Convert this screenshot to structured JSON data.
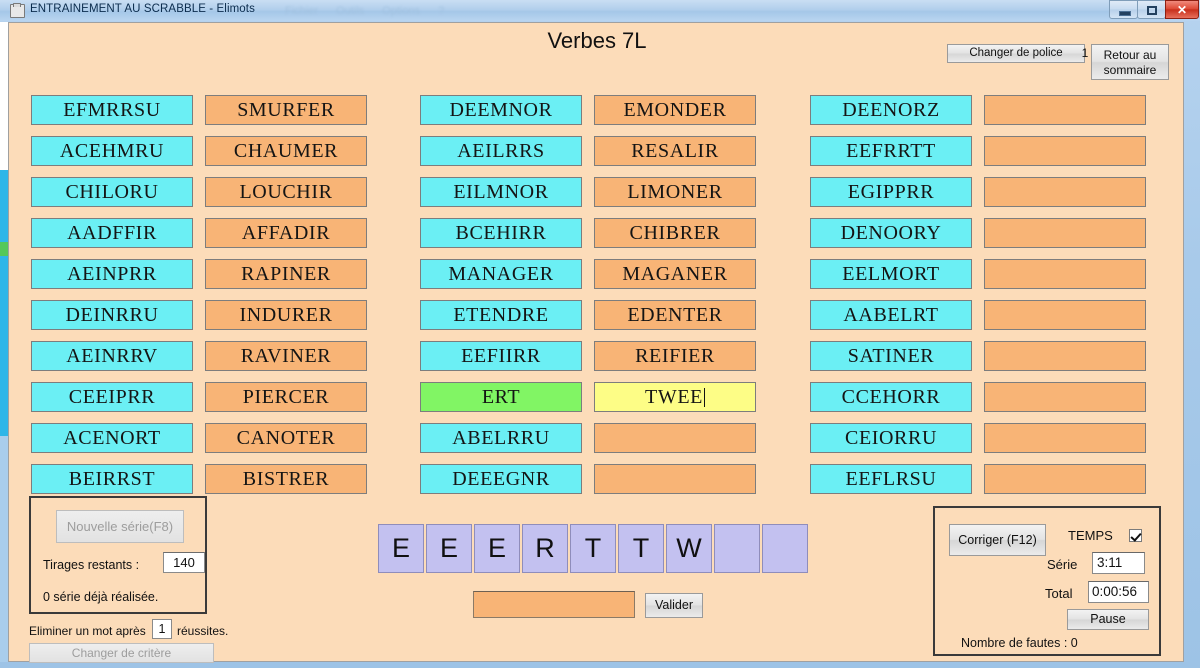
{
  "window": {
    "title": "ENTRAINEMENT AU SCRABBLE - Elimots",
    "icon": "window-app-icon",
    "menu_ghost": [
      "Fichier",
      "Outils",
      "Options",
      "?"
    ],
    "controls": {
      "minimize": "minimize-icon",
      "maximize": "maximize-icon",
      "close": "✕"
    }
  },
  "header": {
    "page_title": "Verbes 7L",
    "change_font_button": "Changer de police",
    "font_index": "1",
    "back_button": "Retour au sommaire"
  },
  "grid": {
    "columns": [
      {
        "rows": [
          {
            "left": "EFMRRSU",
            "left_state": "cyan",
            "right": "SMURFER",
            "right_state": "orange"
          },
          {
            "left": "ACEHMRU",
            "left_state": "cyan",
            "right": "CHAUMER",
            "right_state": "orange"
          },
          {
            "left": "CHILORU",
            "left_state": "cyan",
            "right": "LOUCHIR",
            "right_state": "orange"
          },
          {
            "left": "AADFFIR",
            "left_state": "cyan",
            "right": "AFFADIR",
            "right_state": "orange"
          },
          {
            "left": "AEINPRR",
            "left_state": "cyan",
            "right": "RAPINER",
            "right_state": "orange"
          },
          {
            "left": "DEINRRU",
            "left_state": "cyan",
            "right": "INDURER",
            "right_state": "orange"
          },
          {
            "left": "AEINRRV",
            "left_state": "cyan",
            "right": "RAVINER",
            "right_state": "orange"
          },
          {
            "left": "CEEIPRR",
            "left_state": "cyan",
            "right": "PIERCER",
            "right_state": "orange"
          },
          {
            "left": "ACENORT",
            "left_state": "cyan",
            "right": "CANOTER",
            "right_state": "orange"
          },
          {
            "left": "BEIRRST",
            "left_state": "cyan",
            "right": "BISTRER",
            "right_state": "orange"
          }
        ]
      },
      {
        "rows": [
          {
            "left": "DEEMNOR",
            "left_state": "cyan",
            "right": "EMONDER",
            "right_state": "orange"
          },
          {
            "left": "AEILRRS",
            "left_state": "cyan",
            "right": "RESALIR",
            "right_state": "orange"
          },
          {
            "left": "EILMNOR",
            "left_state": "cyan",
            "right": "LIMONER",
            "right_state": "orange"
          },
          {
            "left": "BCEHIRR",
            "left_state": "cyan",
            "right": "CHIBRER",
            "right_state": "orange"
          },
          {
            "left": "MANAGER",
            "left_state": "cyan",
            "right": "MAGANER",
            "right_state": "orange"
          },
          {
            "left": "ETENDRE",
            "left_state": "cyan",
            "right": "EDENTER",
            "right_state": "orange"
          },
          {
            "left": "EEFIIRR",
            "left_state": "cyan",
            "right": "REIFIER",
            "right_state": "orange"
          },
          {
            "left": "ERT",
            "left_state": "green",
            "right": "TWEE",
            "right_state": "yellow",
            "right_caret": true
          },
          {
            "left": "ABELRRU",
            "left_state": "cyan",
            "right": "",
            "right_state": "orange"
          },
          {
            "left": "DEEEGNR",
            "left_state": "cyan",
            "right": "",
            "right_state": "orange"
          }
        ]
      },
      {
        "rows": [
          {
            "left": "DEENORZ",
            "left_state": "cyan",
            "right": "",
            "right_state": "orange"
          },
          {
            "left": "EEFRRTT",
            "left_state": "cyan",
            "right": "",
            "right_state": "orange"
          },
          {
            "left": "EGIPPRR",
            "left_state": "cyan",
            "right": "",
            "right_state": "orange"
          },
          {
            "left": "DENOORY",
            "left_state": "cyan",
            "right": "",
            "right_state": "orange"
          },
          {
            "left": "EELMORT",
            "left_state": "cyan",
            "right": "",
            "right_state": "orange"
          },
          {
            "left": "AABELRT",
            "left_state": "cyan",
            "right": "",
            "right_state": "orange"
          },
          {
            "left": "SATINER",
            "left_state": "cyan",
            "right": "",
            "right_state": "orange"
          },
          {
            "left": "CCEHORR",
            "left_state": "cyan",
            "right": "",
            "right_state": "orange"
          },
          {
            "left": "CEIORRU",
            "left_state": "cyan",
            "right": "",
            "right_state": "orange"
          },
          {
            "left": "EEFLRSU",
            "left_state": "cyan",
            "right": "",
            "right_state": "orange"
          }
        ]
      }
    ]
  },
  "series_panel": {
    "new_series_button": "Nouvelle série(F8)",
    "new_series_disabled": true,
    "remaining_label": "Tirages restants :",
    "remaining_value": "140",
    "done_label": "0 série déjà réalisée.",
    "eliminate_prefix": "Eliminer un mot après",
    "eliminate_value": "1",
    "eliminate_suffix": "réussites.",
    "change_criteria_button": "Changer de critère",
    "change_criteria_disabled": true
  },
  "rack": {
    "tiles": [
      "E",
      "E",
      "E",
      "R",
      "T",
      "T",
      "W",
      "",
      ""
    ]
  },
  "answer": {
    "value": "",
    "validate_button": "Valider"
  },
  "timer_panel": {
    "correct_button": "Corriger (F12)",
    "time_label": "TEMPS",
    "time_checked": true,
    "series_label": "Série",
    "series_value": "3:11",
    "total_label": "Total",
    "total_value": "0:00:56",
    "pause_button": "Pause",
    "faults_label": "Nombre de fautes :  0"
  },
  "colors": {
    "page_bg": "#fcdcb9",
    "cyan": "#6beff4",
    "orange": "#f8b476",
    "green": "#81f564",
    "yellow": "#fdfd86",
    "tile": "#c3c1f0",
    "frame": "#9dc3e6"
  }
}
